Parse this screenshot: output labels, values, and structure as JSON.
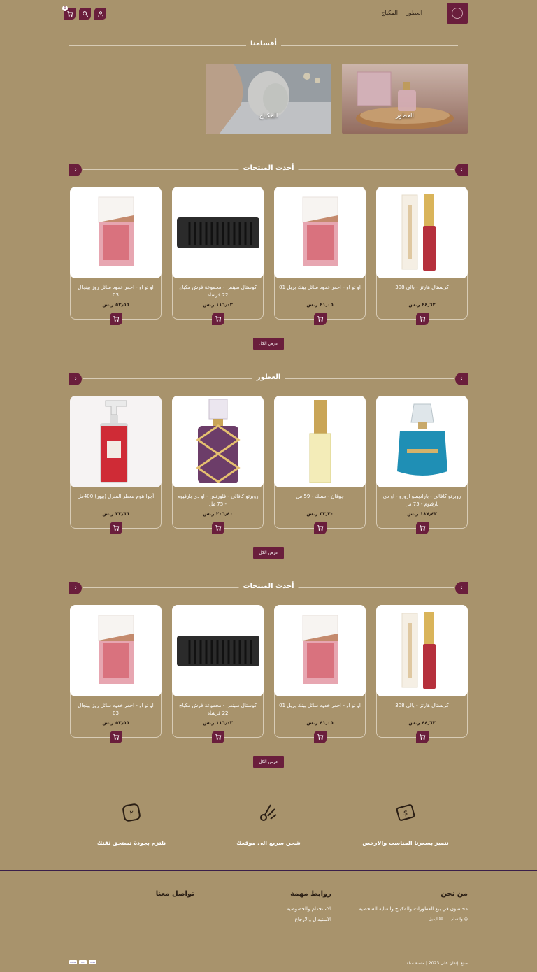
{
  "header": {
    "nav": [
      "العطور",
      "المكياج"
    ],
    "cart_count": "0"
  },
  "categories_title": "أقسامنا",
  "categories": [
    {
      "label": "العطور"
    },
    {
      "label": "المكياج"
    }
  ],
  "sections": [
    {
      "title": "أحدث المنتجات",
      "view_all": "عرض الكل",
      "products": [
        {
          "name": "كريستال هارتز - بالي 308",
          "price": "٤٤٫٦٢ ر.س"
        },
        {
          "name": "او تو او - احمر خدود سائل بينك بريل 01",
          "price": "٤١٫٠٥ ر.س"
        },
        {
          "name": "كوستال سينس - مجموعة فرش مكياج 22 فرشاة",
          "price": "١١٦٫٠٣ ر.س"
        },
        {
          "name": "او تو او - احمر خدود سائل روز بينجال 03",
          "price": "٥٣٫٥٥ ر.س"
        }
      ]
    },
    {
      "title": "العطور",
      "view_all": "عرض الكل",
      "products": [
        {
          "name": "روبرتو كافالي - باراديسو ازورو - او دي بارفيوم - 75 مل",
          "price": "١٨٧٫٤٣ ر.س"
        },
        {
          "name": "جوفان - مسك - 59 مل",
          "price": "٣٣٫٢٠ ر.س"
        },
        {
          "name": "روبرتو كافالي - فلورنس - او دي بارفيوم - 75 مل",
          "price": "٢٠٦٫٤٠ ر.س"
        },
        {
          "name": "أجوا هوم معطر المنزل (بيور) 400مل",
          "price": "٣٣٫٦٦ ر.س"
        }
      ]
    },
    {
      "title": "أحدث المنتجات",
      "view_all": "عرض الكل",
      "products": [
        {
          "name": "كريستال هارتز - بالي 308",
          "price": "٤٤٫٦٢ ر.س"
        },
        {
          "name": "او تو او - احمر خدود سائل بينك بريل 01",
          "price": "٤١٫٠٥ ر.س"
        },
        {
          "name": "كوستال سينس - مجموعة فرش مكياج 22 فرشاة",
          "price": "١١٦٫٠٣ ر.س"
        },
        {
          "name": "او تو او - احمر خدود سائل روز بينجال 03",
          "price": "٥٣٫٥٥ ر.س"
        }
      ]
    }
  ],
  "features": [
    {
      "text": "نتميز بسعرنا المناسب والارخص",
      "icon": "price-tag-icon"
    },
    {
      "text": "شحن سريع الى موقعك",
      "icon": "delivery-icon"
    },
    {
      "text": "نلتزم بجودة تستحق ثقتك",
      "icon": "quality-icon"
    }
  ],
  "footer": {
    "about_title": "من نحن",
    "about_text": "مختصون في بيع العطورات والمكياج والعناية الشخصية",
    "whatsapp": "واتساب",
    "email": "ايميل",
    "links_title": "روابط مهمة",
    "links": [
      "الاستخدام والخصوصية",
      "الاستبدال والارجاع"
    ],
    "contact_title": "تواصل معنا",
    "copyright": "صنع بإتقان على  2023 | منصة سلة",
    "payments": [
      "mada",
      "mc",
      "VISA"
    ]
  },
  "colors": {
    "background": "#a8936c",
    "accent": "#6a1e3c"
  }
}
